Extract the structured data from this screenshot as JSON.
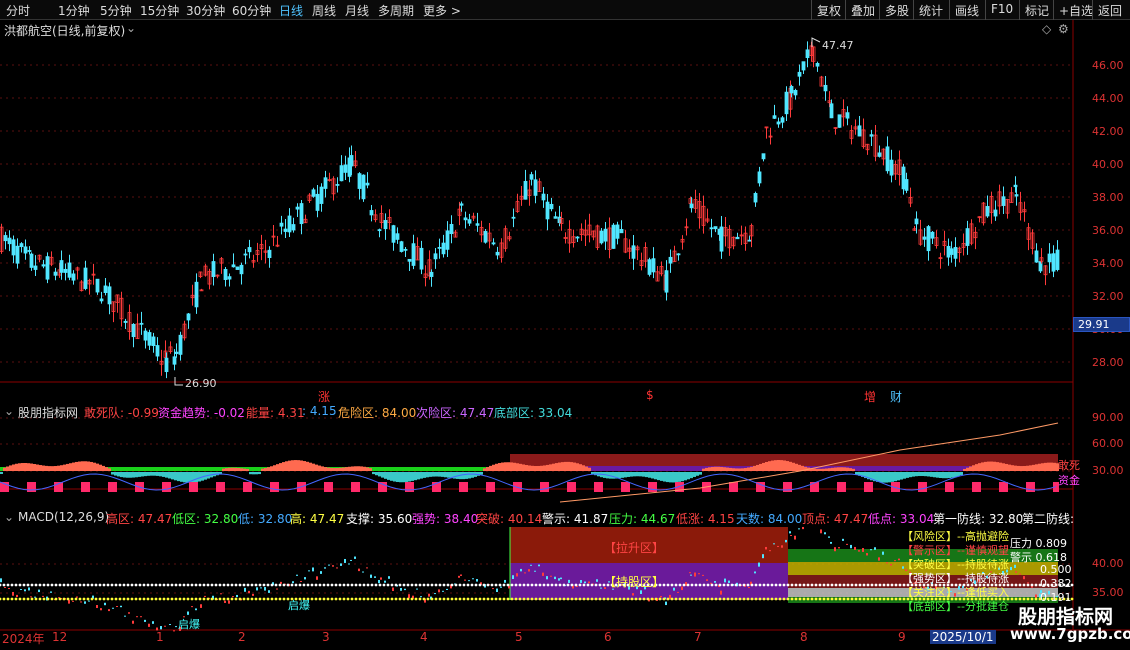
{
  "toolbar": {
    "left": [
      "分时",
      "1分钟",
      "5分钟",
      "15分钟",
      "30分钟",
      "60分钟",
      "日线",
      "周线",
      "月线",
      "多周期",
      "更多 >"
    ],
    "active": "日线",
    "right": [
      "复权",
      "叠加",
      "多股",
      "统计",
      "画线",
      "F10",
      "标记",
      "+自选",
      "返回"
    ]
  },
  "main": {
    "title": "洪都航空(日线,前复权)",
    "price_axis": [
      "46.00",
      "44.00",
      "42.00",
      "40.00",
      "38.00",
      "36.00",
      "34.00",
      "32.00",
      "30.00",
      "28.00"
    ],
    "current_price": "29.91",
    "high_label": "47.47",
    "low_label": "26.90",
    "markers": [
      {
        "text": "涨",
        "color": "#ff3333"
      },
      {
        "text": "$",
        "color": "#ff3333"
      },
      {
        "text": "增",
        "color": "#ff3333"
      },
      {
        "text": "财",
        "color": "#4fc3ff"
      }
    ]
  },
  "indicator1": {
    "name": "股朋指标网",
    "items": [
      {
        "label": "敢死队: -0.99",
        "color": "#ff4444"
      },
      {
        "label": "资金趋势: -0.02",
        "color": "#ff44ff"
      },
      {
        "label": "能量: 4.31",
        "color": "#ff4444"
      },
      {
        "label": ": 4.15",
        "color": "#44aaff"
      },
      {
        "label": "危险区: 84.00",
        "color": "#ffaa44"
      },
      {
        "label": "次险区: 47.47",
        "color": "#cc66ff"
      },
      {
        "label": "底部区: 33.04",
        "color": "#44dddd"
      }
    ],
    "axis": [
      "90.00",
      "60.00",
      "30.00"
    ],
    "right_labels": [
      {
        "text": "敢死",
        "color": "#ff4444"
      },
      {
        "text": "资金",
        "color": "#ff44ff"
      }
    ]
  },
  "indicator2": {
    "name": "MACD(12,26,9)",
    "items": [
      {
        "label": "高区: 47.47",
        "color": "#ff4444"
      },
      {
        "label": "低区: 32.80",
        "color": "#44ff44"
      },
      {
        "label": "低: 32.80",
        "color": "#44aaff"
      },
      {
        "label": "高: 47.47",
        "color": "#ffff44"
      },
      {
        "label": "支撑: 35.60",
        "color": "#ffffff"
      },
      {
        "label": "强势: 38.40",
        "color": "#ff44ff"
      },
      {
        "label": "突破: 40.14",
        "color": "#ff4444"
      },
      {
        "label": "警示: 41.87",
        "color": "#ffffff"
      },
      {
        "label": "压力: 44.67",
        "color": "#44ff44"
      },
      {
        "label": "低涨: 4.15",
        "color": "#ff4444"
      },
      {
        "label": "天数: 84.00",
        "color": "#44aaff"
      },
      {
        "label": "顶点: 47.47",
        "color": "#ff4444"
      },
      {
        "label": "低点: 33.04",
        "color": "#ff44ff"
      },
      {
        "label": "第一防线: 32.80",
        "color": "#ffffff"
      },
      {
        "label": "第二防线:",
        "color": "#ffffff"
      }
    ],
    "axis": [
      "40.00",
      "35.00"
    ],
    "zone_labels": [
      "【拉升区】",
      "【持股区】"
    ],
    "right_zones": [
      {
        "text": "【风险区】--高抛避险",
        "color": "#ffff44"
      },
      {
        "text": "【警示区】--谨慎观望",
        "color": "#ff4444"
      },
      {
        "text": "【突破区】--持股待涨",
        "color": "#ffff44"
      },
      {
        "text": "【强势区】--持股待涨",
        "color": "#ffffff"
      },
      {
        "text": "【关注区】--逢低买入",
        "color": "#ffff44"
      },
      {
        "text": "【底部区】--分批建仓",
        "color": "#44ff44"
      }
    ],
    "right_values": [
      {
        "text": "压力 0.809",
        "color": "#ffffff"
      },
      {
        "text": "警示 0.618",
        "color": "#ffffff"
      },
      {
        "text": "0.500",
        "color": "#ffffff"
      },
      {
        "text": "0.382",
        "color": "#ffffff"
      },
      {
        "text": "0.191",
        "color": "#ffffff"
      }
    ],
    "notes": [
      "启爆",
      "启爆"
    ]
  },
  "dates": [
    "2024年",
    "12",
    "1",
    "2",
    "3",
    "4",
    "5",
    "6",
    "7",
    "8",
    "9",
    "2025/10/1"
  ],
  "watermark": {
    "title": "股朋指标网",
    "url": "www.7gpzb.com"
  }
}
